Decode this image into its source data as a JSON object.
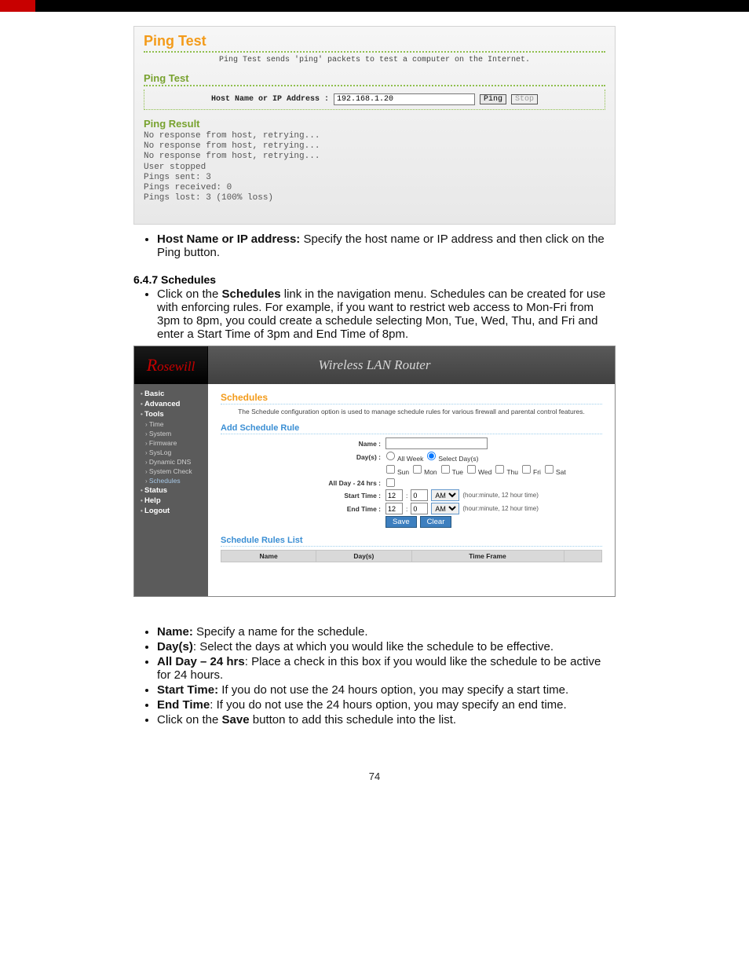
{
  "page_number": "74",
  "panel": {
    "title": "Ping Test",
    "description": "Ping Test sends 'ping' packets to test a computer on the Internet.",
    "ping_test_heading": "Ping Test",
    "host_label": "Host Name or IP Address :",
    "host_value": "192.168.1.20",
    "ping_btn": "Ping",
    "stop_btn": "Stop",
    "result_heading": "Ping Result",
    "result_text": "No response from host, retrying...\nNo response from host, retrying...\nNo response from host, retrying...\nUser stopped\nPings sent: 3\nPings received: 0\nPings lost: 3 (100% loss)"
  },
  "bullets1": {
    "host": {
      "label": "Host Name or IP address:",
      "text": " Specify the host name or IP address and then click on the Ping button."
    }
  },
  "section": {
    "num": "6.4.7  Schedules",
    "para_pre": "Click on the ",
    "para_link": "Schedules",
    "para_post": " link in the navigation menu. Schedules can be created for use with enforcing rules. For example, if you want to restrict web access to Mon-Fri from 3pm to 8pm, you could create a schedule selecting Mon, Tue, Wed, Thu, and Fri and enter a Start Time of 3pm and End Time of 8pm."
  },
  "router": {
    "logo": "Rosewill",
    "title": "Wireless LAN Router",
    "sidebar": {
      "basic": "Basic",
      "advanced": "Advanced",
      "tools": "Tools",
      "time": "Time",
      "system": "System",
      "firmware": "Firmware",
      "syslog": "SysLog",
      "dyndns": "Dynamic DNS",
      "syscheck": "System Check",
      "schedules": "Schedules",
      "status": "Status",
      "help": "Help",
      "logout": "Logout"
    },
    "main": {
      "h_schedules": "Schedules",
      "desc": "The Schedule configuration option is used to manage schedule rules for various firewall and parental control features.",
      "h_add": "Add Schedule Rule",
      "name_label": "Name :",
      "name_value": "",
      "days_label": "Day(s) :",
      "opt_all_week": "All Week",
      "opt_select_days": "Select Day(s)",
      "d_sun": "Sun",
      "d_mon": "Mon",
      "d_tue": "Tue",
      "d_wed": "Wed",
      "d_thu": "Thu",
      "d_fri": "Fri",
      "d_sat": "Sat",
      "allday_label": "All Day - 24 hrs :",
      "start_label": "Start Time :",
      "end_label": "End Time :",
      "h_val": "12",
      "m_val": "0",
      "ampm": "AM",
      "time_hint": "(hour:minute, 12 hour time)",
      "save": "Save",
      "clear": "Clear",
      "h_rules": "Schedule Rules List",
      "col_name": "Name",
      "col_days": "Day(s)",
      "col_time": "Time Frame"
    }
  },
  "bullets2": {
    "name": {
      "label": "Name:",
      "text": " Specify a name for the schedule."
    },
    "days": {
      "label": "Day(s)",
      "text": ": Select the days at which you would like the schedule to be effective."
    },
    "allday": {
      "label": "All Day – 24 hrs",
      "text": ": Place a check in this box if you would like the schedule to be active for 24 hours."
    },
    "start": {
      "label": "Start Time:",
      "text": " If you do not use the 24 hours option, you may specify a start time."
    },
    "end": {
      "label": "End Time",
      "text": ": If you do not use the 24 hours option, you may specify an end time."
    },
    "save": {
      "pre": "Click on the ",
      "label": "Save",
      "text": " button to add this schedule into the list."
    }
  }
}
